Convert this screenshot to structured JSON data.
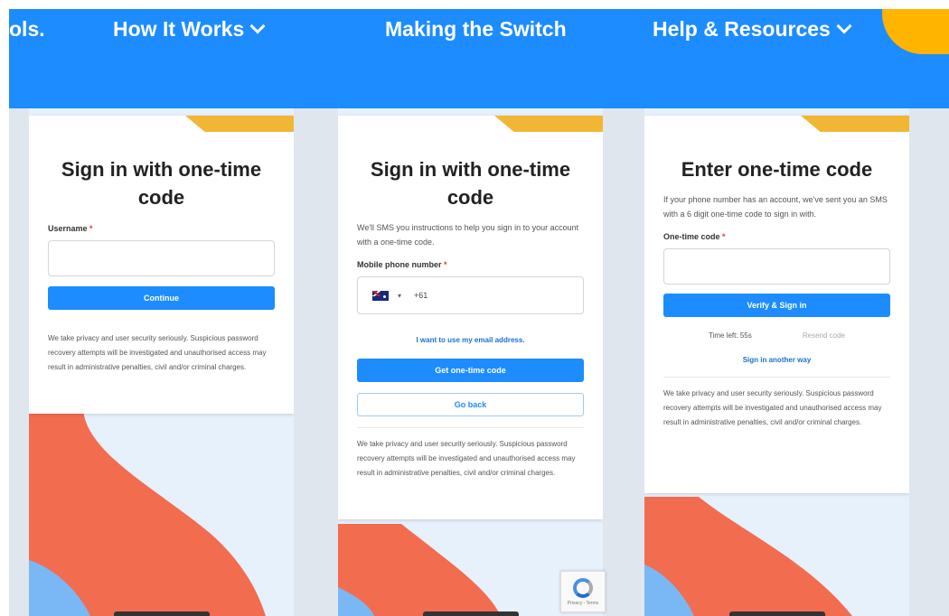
{
  "nav": {
    "items": [
      {
        "label": "ols.",
        "has_chevron": false
      },
      {
        "label": "How It Works",
        "has_chevron": true
      },
      {
        "label": "Making the Switch",
        "has_chevron": false
      },
      {
        "label": "Help & Resources",
        "has_chevron": true
      }
    ]
  },
  "screens": [
    {
      "title": "Sign in with one-time code",
      "field_label": "Username",
      "required_mark": "*",
      "username_value": "",
      "continue_label": "Continue",
      "privacy": "We take privacy and user security seriously. Suspicious password recovery attempts will be investigated and unauthorised access may result in administrative penalties, civil and/or criminal charges."
    },
    {
      "title": "Sign in with one-time code",
      "description": "We'll SMS you instructions to help you sign in to your account with a one-time code.",
      "field_label": "Mobile phone number",
      "required_mark": "*",
      "country_code": "+61",
      "caret": "▾",
      "email_link": "I want to use my email address.",
      "primary_label": "Get one-time code",
      "secondary_label": "Go back",
      "privacy": "We take privacy and user security seriously. Suspicious password recovery attempts will be investigated and unauthorised access may result in administrative penalties, civil and/or criminal charges."
    },
    {
      "title": "Enter one-time code",
      "description": "If your phone number has an account, we've sent you an SMS with a 6 digit one-time code to sign in with.",
      "field_label": "One-time code",
      "required_mark": "*",
      "code_value": "",
      "primary_label": "Verify & Sign in",
      "timer": "Time left: 55s",
      "resend_label": "Resend code",
      "other_way_link": "Sign in another way",
      "privacy": "We take privacy and user security seriously. Suspicious password recovery attempts will be investigated and unauthorised access may result in administrative penalties, civil and/or criminal charges."
    }
  ],
  "colors": {
    "brand_blue": "#1c8cff",
    "accent_yellow": "#ffb400",
    "accent_orange": "#f26c50",
    "accent_light_blue": "#7ab8f5"
  },
  "recaptcha": {
    "icon": "recaptcha-icon",
    "text": "Privacy - Terms"
  }
}
